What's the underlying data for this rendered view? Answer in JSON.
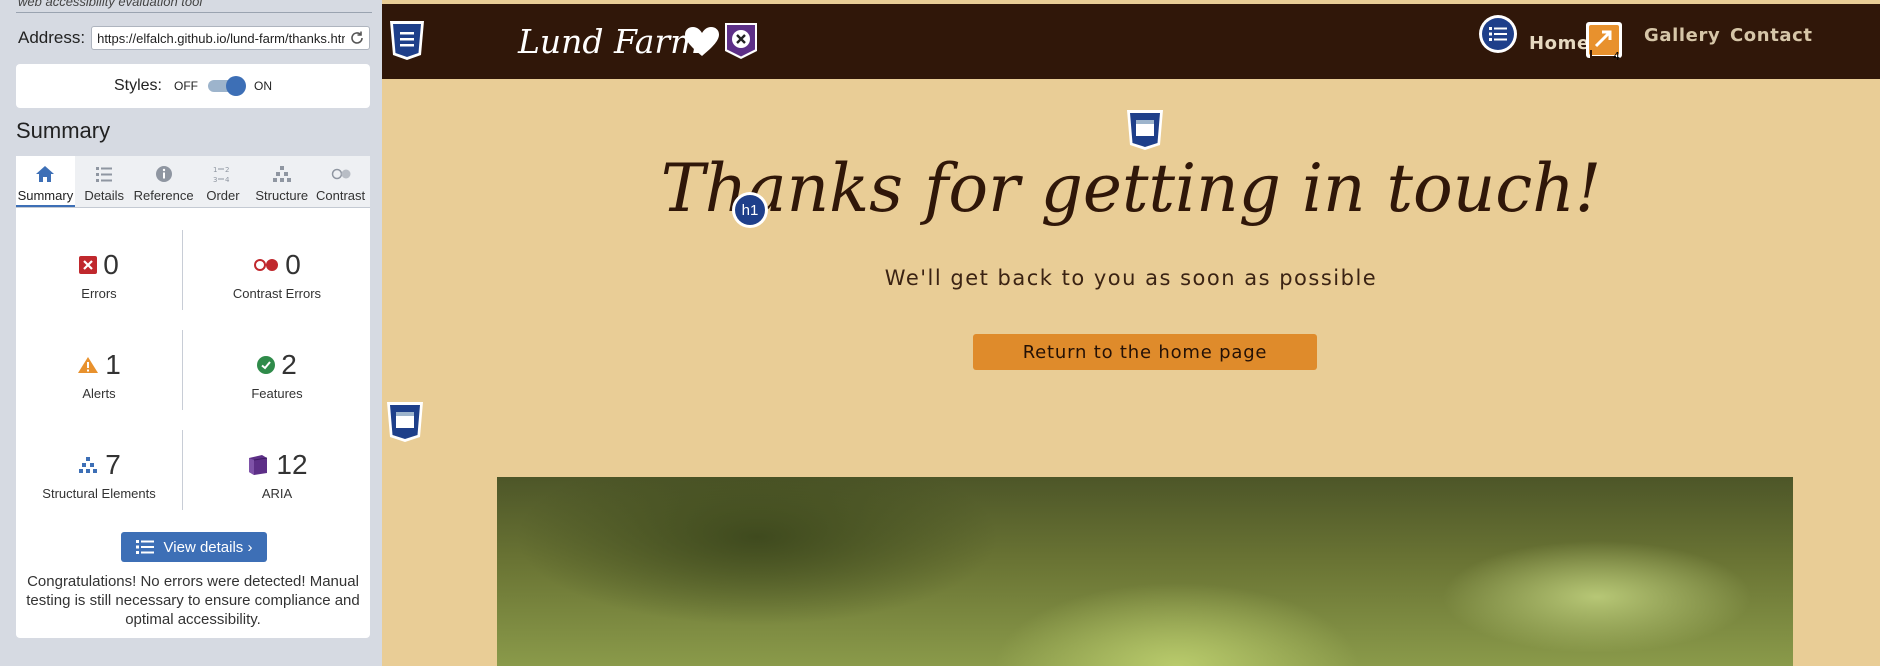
{
  "sidebar": {
    "tagline": "web accessibility evaluation tool",
    "address_label": "Address:",
    "address_value": "https://elfalch.github.io/lund-farm/thanks.html",
    "styles_label": "Styles:",
    "styles_off": "OFF",
    "styles_on": "ON",
    "summary_heading": "Summary",
    "tabs": [
      {
        "label": "Summary",
        "icon": "home-icon"
      },
      {
        "label": "Details",
        "icon": "list-icon"
      },
      {
        "label": "Reference",
        "icon": "info-icon"
      },
      {
        "label": "Order",
        "icon": "order-icon"
      },
      {
        "label": "Structure",
        "icon": "structure-icon"
      },
      {
        "label": "Contrast",
        "icon": "contrast-icon"
      }
    ],
    "stats": {
      "errors": {
        "count": "0",
        "label": "Errors",
        "color": "#c0282d"
      },
      "contrast_errors": {
        "count": "0",
        "label": "Contrast Errors",
        "color": "#c0282d"
      },
      "alerts": {
        "count": "1",
        "label": "Alerts",
        "color": "#e8912d"
      },
      "features": {
        "count": "2",
        "label": "Features",
        "color": "#2f8b4a"
      },
      "structural": {
        "count": "7",
        "label": "Structural Elements",
        "color": "#3d6fb6"
      },
      "aria": {
        "count": "12",
        "label": "ARIA",
        "color": "#5d2f87"
      }
    },
    "view_details_label": "View details ›",
    "congrats_text": "Congratulations! No errors were detected! Manual testing is still necessary to ensure compliance and optimal accessibility."
  },
  "page": {
    "brand": "Lund Farm",
    "nav": {
      "home": "Home",
      "gallery": "Gallery",
      "contact": "Contact"
    },
    "hero_title": "Thanks for getting in touch!",
    "hero_subtitle": "We'll get back to you as soon as possible",
    "return_button": "Return to the home page",
    "h1_badge": "h1",
    "colors": {
      "navbar": "#301709",
      "background": "#e9cd96",
      "button": "#df8b2b"
    }
  }
}
